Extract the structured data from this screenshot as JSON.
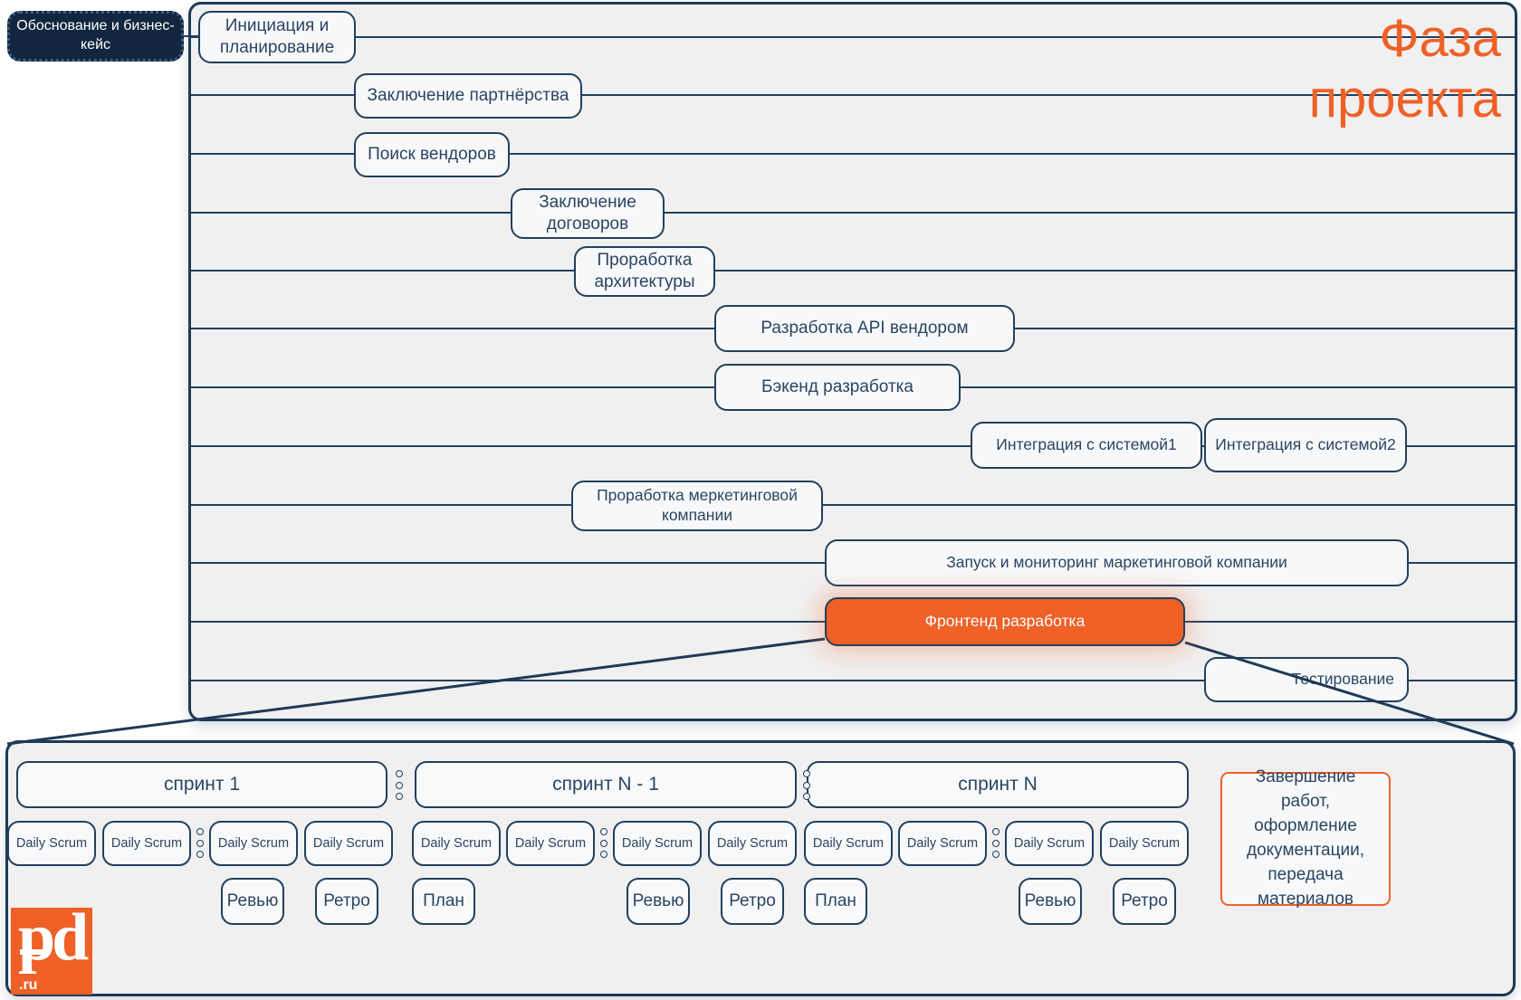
{
  "badge": {
    "label": "Обоснование и бизнес-кейс"
  },
  "phase": {
    "title_line1": "Фаза",
    "title_line2": "проекта"
  },
  "tasks": [
    {
      "label": "Инициация и планирование"
    },
    {
      "label": "Заключение партнёрства"
    },
    {
      "label": "Поиск вендоров"
    },
    {
      "label": "Заключение договоров"
    },
    {
      "label": "Проработка архитектуры"
    },
    {
      "label": "Разработка API вендором"
    },
    {
      "label": "Бэкенд разработка"
    },
    {
      "label": "Интеграция с системой1"
    },
    {
      "label": "Интеграция с системой2"
    },
    {
      "label": "Проработка меркетинговой компании"
    },
    {
      "label": "Запуск и мониторинг маркетинговой компании"
    },
    {
      "label": "Фронтенд разработка"
    },
    {
      "label": "Тестирование"
    }
  ],
  "sprints": [
    {
      "title": "спринт 1"
    },
    {
      "title": "спринт N - 1"
    },
    {
      "title": "спринт N"
    }
  ],
  "daily_scrum_label": "Daily Scrum",
  "events": {
    "plan": "План",
    "review": "Ревью",
    "retro": "Ретро"
  },
  "completion": {
    "label": "Завершение работ, оформление документации, передача материалов"
  },
  "logo": {
    "mark": "pd",
    "tld": ".ru"
  },
  "colors": {
    "accent_orange": "#ef6127",
    "ink_navy": "#22405e",
    "badge_navy": "#12263f",
    "panel_gray": "#f0f0f0"
  }
}
